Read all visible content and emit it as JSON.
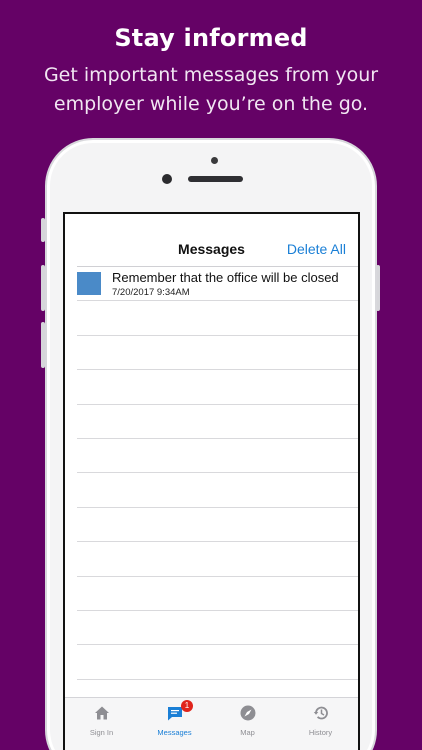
{
  "promo": {
    "headline": "Stay informed",
    "subtitle_line1": "Get important messages from your",
    "subtitle_line2": "employer while you’re on the go."
  },
  "navbar": {
    "title": "Messages",
    "action_label": "Delete All"
  },
  "messages": [
    {
      "text": "Remember that the office will be closed",
      "date": "7/20/2017 9:34AM",
      "swatch_color": "#4a8ac8"
    }
  ],
  "tabbar": {
    "active_tab": "Messages",
    "tabs": [
      {
        "label": "Sign In",
        "icon": "home-icon"
      },
      {
        "label": "Messages",
        "icon": "message-icon",
        "badge": "1"
      },
      {
        "label": "Map",
        "icon": "compass-icon"
      },
      {
        "label": "History",
        "icon": "history-icon"
      }
    ]
  },
  "colors": {
    "background": "#650266",
    "accent": "#1a7fd6",
    "badge": "#e0241c"
  }
}
